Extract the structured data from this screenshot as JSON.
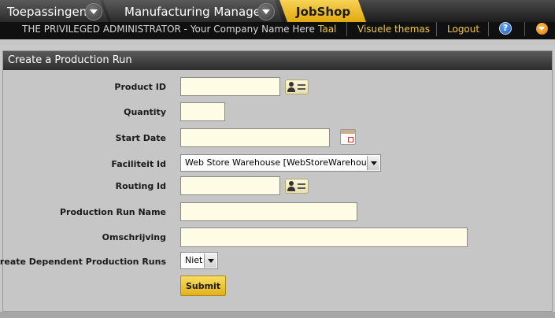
{
  "breadcrumbs": {
    "items": [
      {
        "label": "Toepassingen"
      },
      {
        "label": "Manufacturing Manager"
      },
      {
        "label": "JobShop"
      }
    ]
  },
  "userbar": {
    "user_text": "THE PRIVILEGED ADMINISTRATOR - Your Company Name Here",
    "taal": "Taal",
    "visuele_themas": "Visuele themas",
    "logout": "Logout",
    "help_glyph": "?"
  },
  "colors": {
    "accent": "#f2c744",
    "active_tab": "#f0c43a",
    "input_bg": "#fffce6",
    "panel_header": "#3a3a3a",
    "help_icon": "#2f7ad6",
    "menu_icon": "#f29a1a"
  },
  "icons": {
    "breadcrumb_dropdown": "chevron-down-icon",
    "lookup": "contact-card-icon",
    "calendar": "calendar-icon",
    "help": "help-icon",
    "menu": "menu-dropdown-icon"
  },
  "form": {
    "title": "Create a Production Run",
    "product_id": {
      "label": "Product ID",
      "value": ""
    },
    "quantity": {
      "label": "Quantity",
      "value": ""
    },
    "start_date": {
      "label": "Start Date",
      "value": ""
    },
    "facility": {
      "label": "Faciliteit Id",
      "value": "Web Store Warehouse [WebStoreWarehouse]"
    },
    "routing_id": {
      "label": "Routing Id",
      "value": ""
    },
    "run_name": {
      "label": "Production Run Name",
      "value": ""
    },
    "description": {
      "label": "Omschrijving",
      "value": ""
    },
    "dependent_runs": {
      "label": "Create Dependent Production Runs",
      "value": "Niet"
    },
    "submit_label": "Submit"
  }
}
